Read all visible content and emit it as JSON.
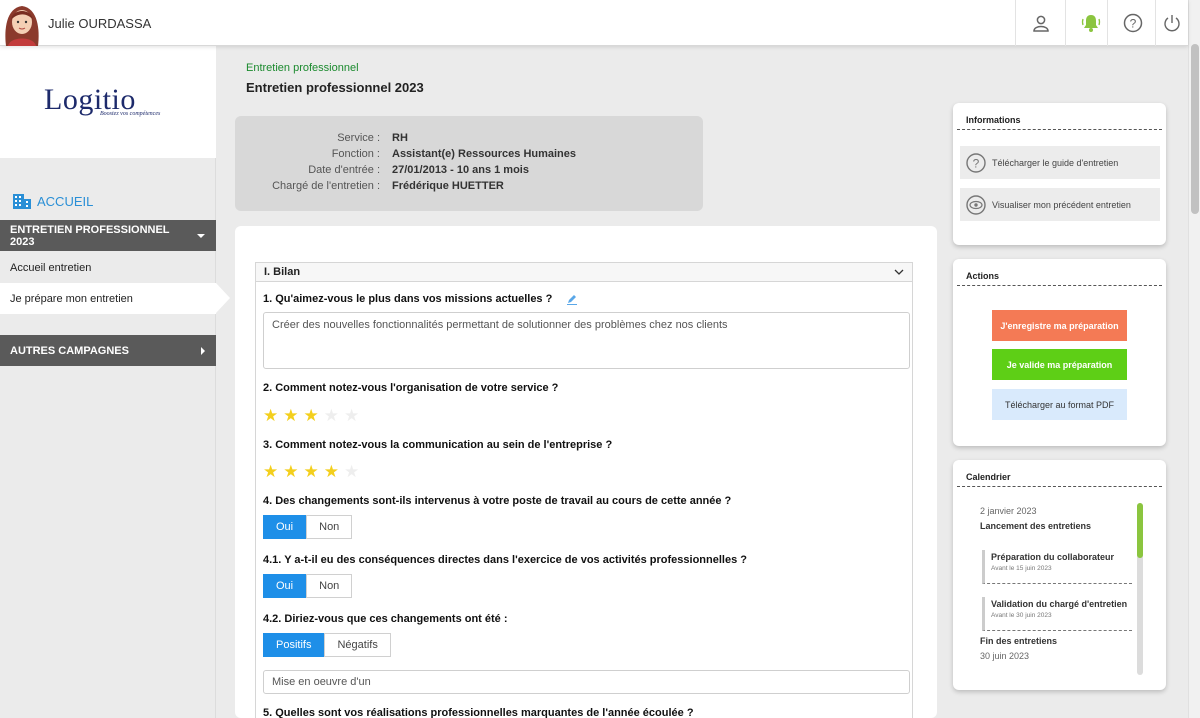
{
  "header": {
    "user_name": "Julie OURDASSA"
  },
  "brand": {
    "logo": "Logitio",
    "tagline": "Boostez vos compétences"
  },
  "sidebar": {
    "home": "ACCUEIL",
    "campaign": "ENTRETIEN PROFESSIONNEL 2023",
    "items": [
      "Accueil entretien",
      "Je prépare mon entretien"
    ],
    "other": "AUTRES CAMPAGNES"
  },
  "breadcrumb": "Entretien professionnel",
  "page_title": "Entretien professionnel 2023",
  "info": {
    "service_label": "Service :",
    "service": "RH",
    "fonction_label": "Fonction :",
    "fonction": "Assistant(e) Ressources Humaines",
    "date_label": "Date d'entrée :",
    "date": "27/01/2013 - 10 ans 1 mois",
    "charge_label": "Chargé de l'entretien :",
    "charge": "Frédérique HUETTER"
  },
  "section": {
    "title": "I. Bilan",
    "q1": "1. Qu'aimez-vous le plus dans vos missions actuelles ?",
    "a1": "Créer des nouvelles fonctionnalités permettant de solutionner des problèmes chez nos clients",
    "q2": "2. Comment notez-vous l'organisation de votre service ?",
    "q2_rating": 3,
    "q3": "3. Comment notez-vous la communication au sein de l'entreprise ?",
    "q3_rating": 4,
    "q4": "4. Des changements sont-ils intervenus à votre poste de travail au cours de cette année ?",
    "q41": "4.1. Y a-t-il eu des conséquences directes dans l'exercice de vos activités professionnelles ?",
    "yes": "Oui",
    "no": "Non",
    "q42": "4.2. Diriez-vous que ces changements ont été :",
    "positive": "Positifs",
    "negative": "Négatifs",
    "a42": "Mise en oeuvre d'un",
    "q5": "5. Quelles sont vos réalisations professionnelles marquantes de l'année écoulée ?"
  },
  "informations": {
    "title": "Informations",
    "guide": "Télécharger le guide d'entretien",
    "previous": "Visualiser mon précédent entretien"
  },
  "actions": {
    "title": "Actions",
    "save": "J'enregistre ma préparation",
    "validate": "Je valide ma préparation",
    "pdf": "Télécharger au format PDF"
  },
  "calendar": {
    "title": "Calendrier",
    "d1": "2 janvier 2023",
    "e1": "Lancement des entretiens",
    "e2": "Préparation du collaborateur",
    "s2": "Avant le 15 juin 2023",
    "e3": "Validation du chargé d'entretien",
    "s3": "Avant le 30 juin 2023",
    "e4": "Fin des entretiens",
    "d4": "30 juin 2023"
  },
  "colors": {
    "accent": "#1e8fe8",
    "save": "#f47a55",
    "validate": "#5ecf16",
    "pdf": "#d9eafc",
    "nav_dark": "#5a5a5a",
    "breadcrumb": "#1b8a2e"
  }
}
